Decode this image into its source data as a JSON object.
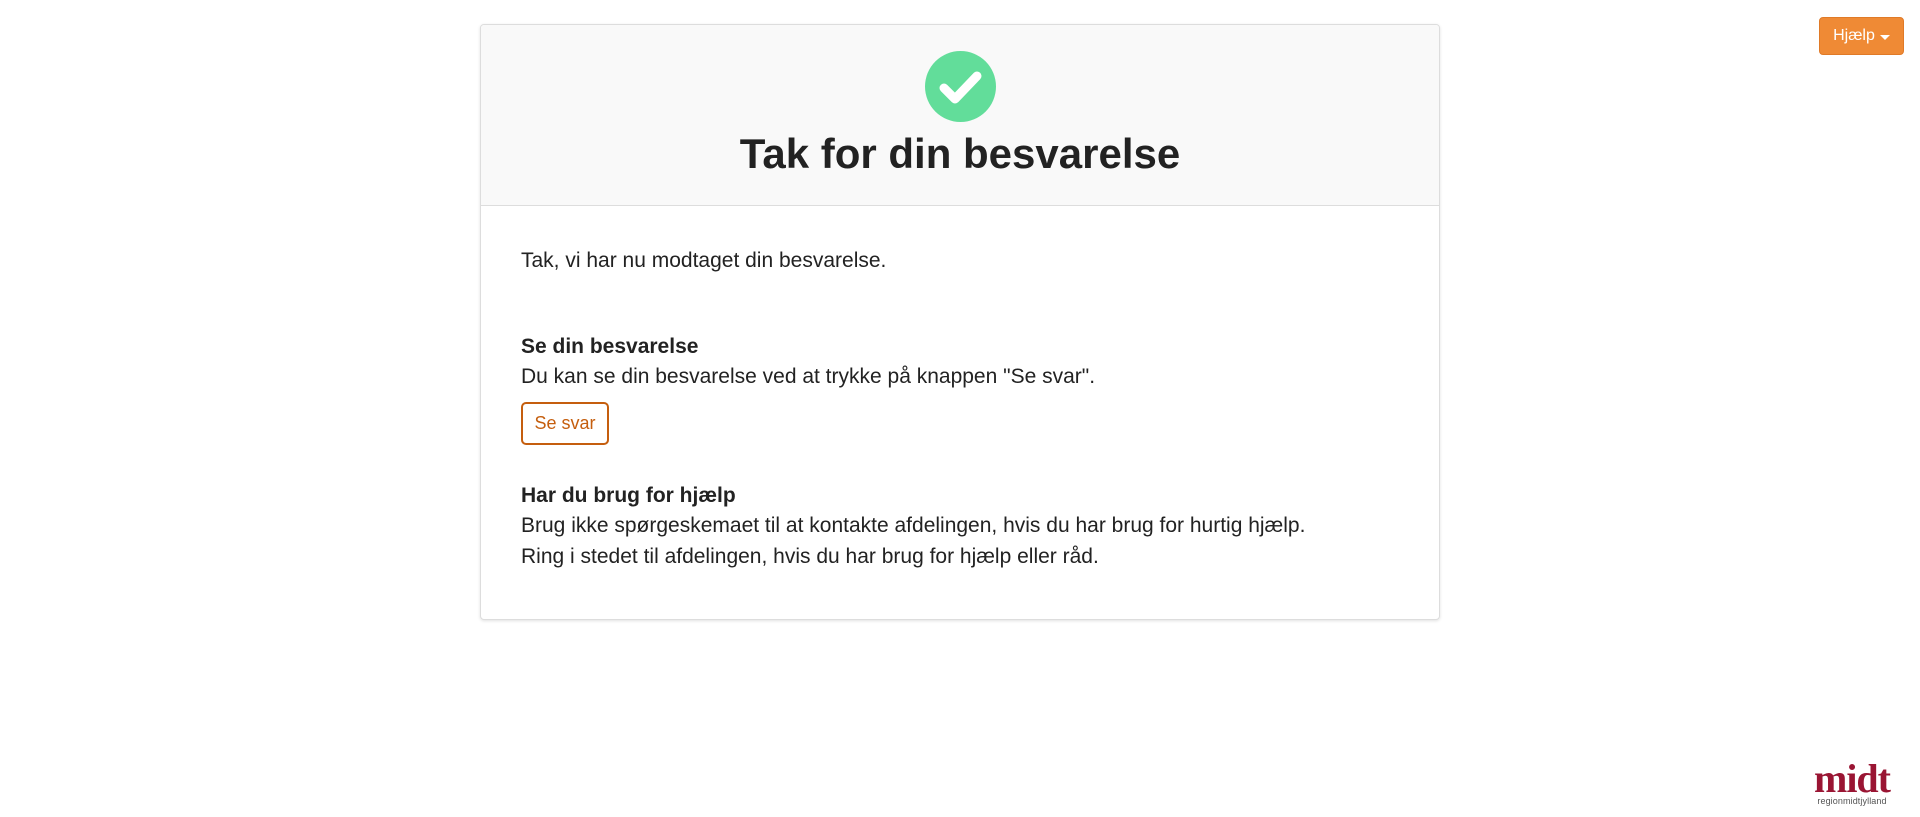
{
  "help_menu": {
    "label": "Hjælp",
    "icon": "caret-down-icon"
  },
  "card": {
    "status_icon": "check-circle-icon",
    "status_color": "#62dd9a",
    "title": "Tak for din besvarelse",
    "intro": "Tak, vi har nu modtaget din besvarelse.",
    "see_section": {
      "heading": "Se din besvarelse",
      "text": "Du kan se din besvarelse ved at trykke på knappen \"Se svar\".",
      "button_label": "Se svar"
    },
    "help_section": {
      "heading": "Har du brug for hjælp",
      "line1": "Brug ikke spørgeskemaet til at kontakte afdelingen, hvis du har brug for hurtig hjælp.",
      "line2": "Ring i stedet til afdelingen, hvis du har brug for hjælp eller råd."
    }
  },
  "logo": {
    "mark": "midt",
    "subtitle": "regionmidtjylland",
    "color": "#9a1533"
  },
  "colors": {
    "accent_orange": "#ef8a35",
    "button_outline": "#c55e0e",
    "success_green": "#62dd9a"
  }
}
